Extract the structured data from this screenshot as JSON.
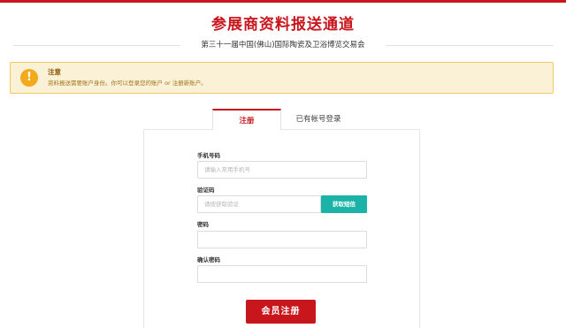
{
  "header": {
    "title": "参展商资料报送通道",
    "subtitle": "第三十一届中国(佛山)国际陶瓷及卫浴博览交易会"
  },
  "notice": {
    "icon": "exclamation-icon",
    "title": "注意",
    "text": "资料报送需要账户身份。你可以登录您的账户 or 注册新账户。"
  },
  "tabs": {
    "register": "注册",
    "login": "已有帐号登录"
  },
  "form": {
    "phone_label": "手机号码",
    "phone_placeholder": "请输入常用手机号",
    "code_label": "验证码",
    "code_placeholder": "请按获取验证",
    "sms_button": "获取短信",
    "password_label": "密码",
    "confirm_label": "确认密码",
    "submit_label": "会员注册"
  },
  "colors": {
    "brand_red": "#c8161d",
    "teal": "#1bb3a7",
    "notice_bg": "#fbf1d7",
    "notice_border": "#f2c95f"
  }
}
